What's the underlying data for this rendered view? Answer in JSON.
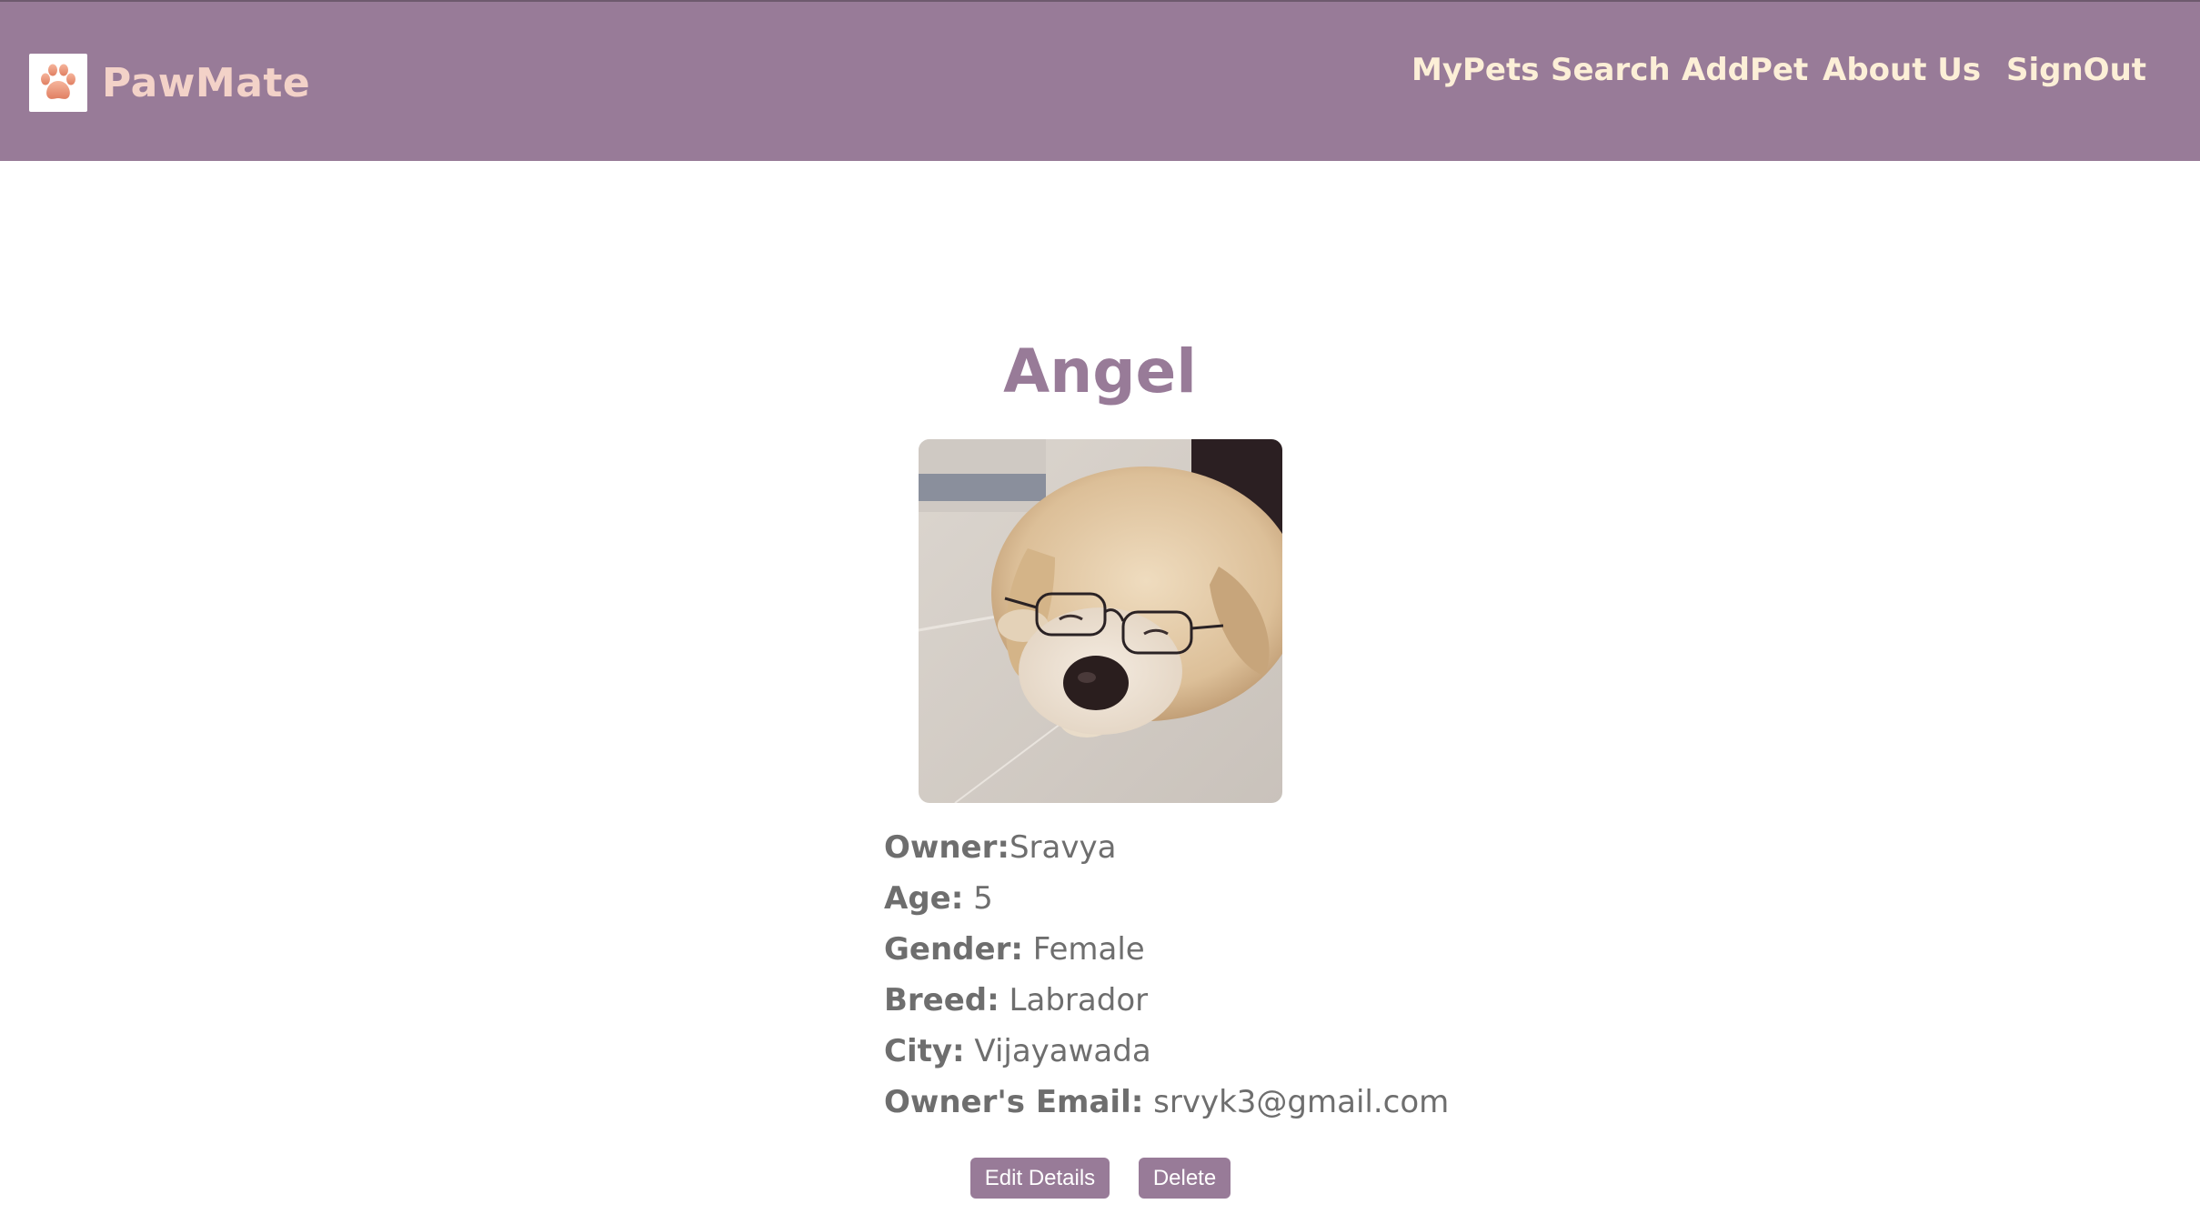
{
  "brand": {
    "name": "PawMate",
    "logo_icon": "paw-icon",
    "logo_color": "#f0a58a"
  },
  "nav": {
    "items": [
      {
        "label": "MyPets"
      },
      {
        "label": "Search"
      },
      {
        "label": "AddPet"
      },
      {
        "label": "About Us"
      },
      {
        "label": "SignOut"
      }
    ]
  },
  "pet": {
    "name": "Angel",
    "photo_description": "dog-photo",
    "details": [
      {
        "key": "Owner:",
        "value": "Sravya"
      },
      {
        "key": "Age:",
        "value": " 5"
      },
      {
        "key": "Gender:",
        "value": " Female"
      },
      {
        "key": "Breed:",
        "value": " Labrador"
      },
      {
        "key": "City:",
        "value": " Vijayawada"
      },
      {
        "key": "Owner's Email:",
        "value": " srvyk3@gmail.com"
      }
    ]
  },
  "actions": {
    "edit_label": "Edit Details",
    "delete_label": "Delete"
  },
  "colors": {
    "primary": "#987b98",
    "nav_text": "#fcefd7",
    "brand_text": "#f3d2c8",
    "detail_text": "#6e6e6e"
  }
}
